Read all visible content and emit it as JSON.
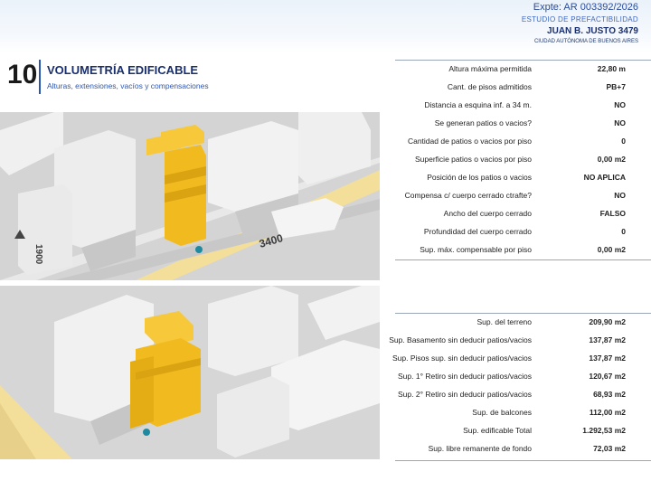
{
  "header": {
    "expte": "Expte: AR 003392/2026",
    "study": "ESTUDIO DE PREFACTIBILIDAD",
    "address": "JUAN B. JUSTO 3479",
    "city": "CIUDAD AUTÓNOMA DE BUENOS AIRES"
  },
  "section": {
    "number": "10",
    "title": "VOLUMETRÍA EDIFICABLE",
    "subtitle": "Alturas, extensiones, vacíos y compensaciones"
  },
  "map1": {
    "street_number": "3400",
    "side_street": "1900"
  },
  "table1": [
    {
      "label": "Altura máxima permitida",
      "value": "22,80 m"
    },
    {
      "label": "Cant. de pisos admitidos",
      "value": "PB+7"
    },
    {
      "label": "Distancia a esquina inf. a 34 m.",
      "value": "NO"
    },
    {
      "label": "Se generan patios o vacios?",
      "value": "NO"
    },
    {
      "label": "Cantidad de patios o vacios por piso",
      "value": "0"
    },
    {
      "label": "Superficie patios o vacios por piso",
      "value": "0,00 m2"
    },
    {
      "label": "Posición de los patios o vacios",
      "value": "NO APLICA"
    },
    {
      "label": "Compensa c/ cuerpo cerrado ctrafte?",
      "value": "NO"
    },
    {
      "label": "Ancho del  cuerpo cerrado",
      "value": "FALSO"
    },
    {
      "label": "Profundidad del  cuerpo cerrado",
      "value": "0"
    },
    {
      "label": "Sup. máx. compensable por piso",
      "value": "0,00 m2"
    }
  ],
  "table2": [
    {
      "label": "Sup. del terreno",
      "value": "209,90 m2"
    },
    {
      "label": "Sup. Basamento sin deducir patios/vacios",
      "value": "137,87 m2"
    },
    {
      "label": "Sup. Pisos sup. sin deducir patios/vacios",
      "value": "137,87 m2"
    },
    {
      "label": "Sup. 1° Retiro sin deducir patios/vacios",
      "value": "120,67 m2"
    },
    {
      "label": "Sup. 2° Retiro sin deducir patios/vacios",
      "value": "68,93 m2"
    },
    {
      "label": "Sup. de balcones",
      "value": "112,00 m2"
    },
    {
      "label": "Sup. edificable Total",
      "value": "1.292,53 m2"
    },
    {
      "label": "Sup. libre remanente de fondo",
      "value": "72,03 m2"
    }
  ],
  "colors": {
    "accent_blue": "#2a57b0",
    "building_yellow": "#f1bb1f",
    "avenue_yellow": "#f3df9a"
  }
}
